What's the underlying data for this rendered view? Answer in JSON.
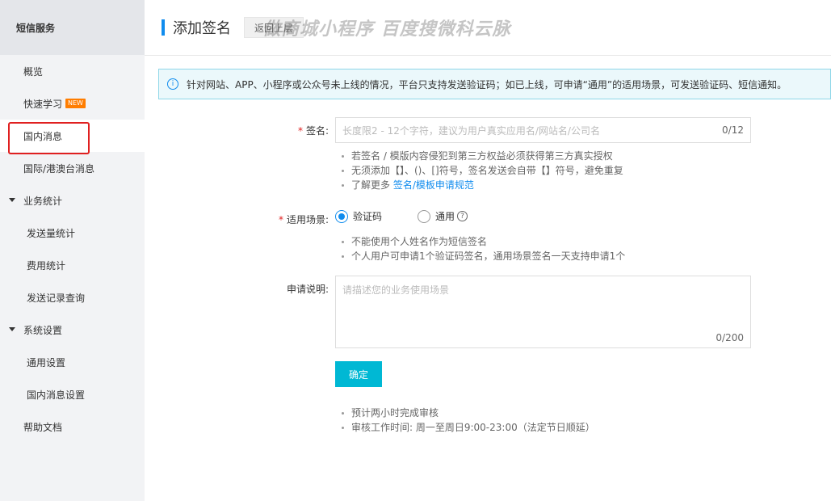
{
  "sidebar": {
    "header": "短信服务",
    "items": [
      {
        "label": "概览"
      },
      {
        "label": "快速学习",
        "badge": "NEW"
      },
      {
        "label": "国内消息"
      },
      {
        "label": "国际/港澳台消息"
      },
      {
        "label": "业务统计"
      },
      {
        "label": "发送量统计"
      },
      {
        "label": "费用统计"
      },
      {
        "label": "发送记录查询"
      },
      {
        "label": "系统设置"
      },
      {
        "label": "通用设置"
      },
      {
        "label": "国内消息设置"
      },
      {
        "label": "帮助文档"
      }
    ]
  },
  "header": {
    "title": "添加签名",
    "back_label": "返回上层",
    "watermark": "做商城小程序 百度搜微科云脉"
  },
  "notice": {
    "text": "针对网站、APP、小程序或公众号未上线的情况，平台只支持发送验证码；如已上线，可申请“通用”的适用场景，可发送验证码、短信通知。"
  },
  "form": {
    "signature": {
      "required": "*",
      "label": "签名:",
      "placeholder": "长度限2 - 12个字符，建议为用户真实应用名/网站名/公司名",
      "count": "0/12",
      "hints": [
        "若签名 / 模版内容侵犯到第三方权益必须获得第三方真实授权",
        "无须添加【】、()、[]符号，签名发送会自带【】符号，避免重复"
      ],
      "more_prefix": "了解更多 ",
      "more_link": "签名/模板申请规范"
    },
    "scene": {
      "required": "*",
      "label": "适用场景:",
      "option1": "验证码",
      "option2": "通用",
      "help": "?",
      "hints": [
        "不能使用个人姓名作为短信签名",
        "个人用户可申请1个验证码签名，通用场景签名一天支持申请1个"
      ]
    },
    "description": {
      "label": "申请说明:",
      "placeholder": "请描述您的业务使用场景",
      "count": "0/200"
    },
    "confirm_label": "确定",
    "footer_hints": [
      "预计两小时完成审核",
      "审核工作时间: 周一至周日9:00-23:00（法定节日顺延）"
    ]
  }
}
